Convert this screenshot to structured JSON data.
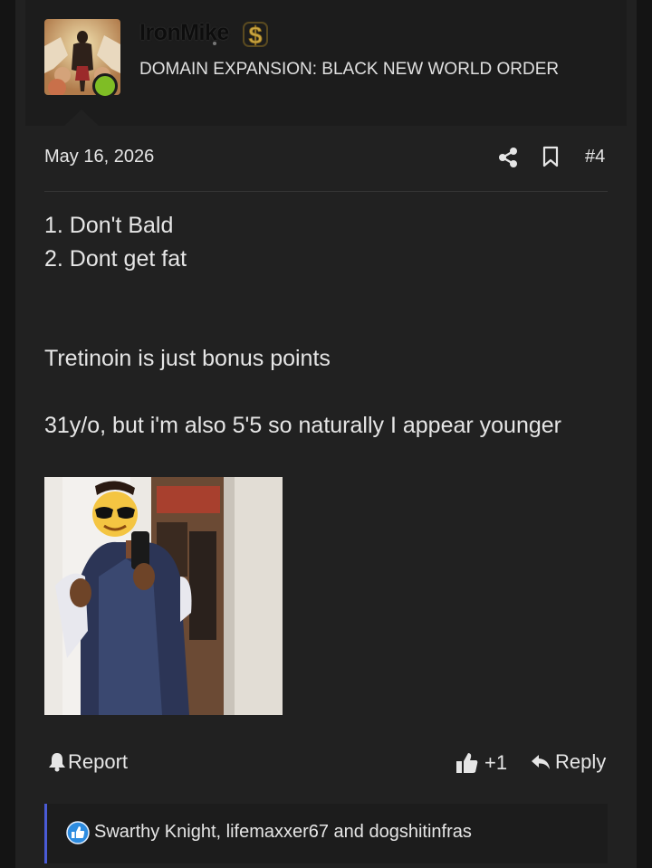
{
  "user": {
    "name": "IronMike",
    "title": "DOMAIN EXPANSION: BLACK NEW WORLD ORDER",
    "online": true
  },
  "post": {
    "date": "May 16, 2026",
    "number": "#4",
    "lines": [
      "1. Don't Bald",
      "2. Dont get fat",
      "Tretinoin is just bonus points",
      "31y/o, but i'm also 5'5 so naturally I appear younger"
    ]
  },
  "actions": {
    "report": "Report",
    "like_count": "+1",
    "reply": "Reply"
  },
  "reactions": {
    "text": "Swarthy Knight, lifemaxxer67 and dogshitinfras"
  },
  "colors": {
    "online": "#7fbd25",
    "reaction_accent": "#4a5bd6",
    "like_blue": "#2d8ce0"
  },
  "icons": [
    "dollar-icon",
    "share-icon",
    "bookmark-icon",
    "bell-icon",
    "thumbs-up-icon",
    "reply-arrow-icon",
    "like-reaction-icon"
  ]
}
